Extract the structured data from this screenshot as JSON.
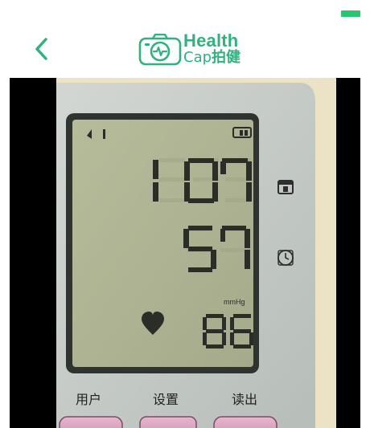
{
  "status_bar": {
    "battery_color": "#28c76f"
  },
  "header": {
    "back_icon": "chevron-left-icon",
    "logo": {
      "icon": "camera-heart-icon",
      "line1": "Health",
      "line2_latin": "Cap",
      "line2_cjk": "拍健",
      "color": "#2fb37e"
    }
  },
  "photo": {
    "systolic": "107",
    "diastolic": "57",
    "pulse": "86",
    "unit": "mmHg",
    "buttons": [
      "用户",
      "设置",
      "读出"
    ]
  }
}
